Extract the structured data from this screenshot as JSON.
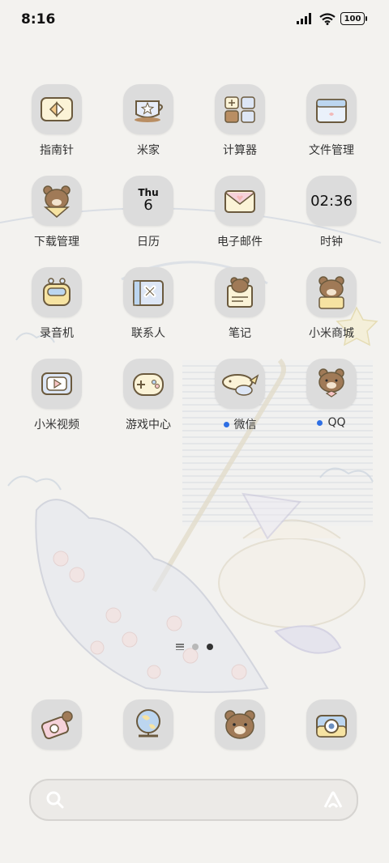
{
  "status": {
    "time": "8:16",
    "battery": "100"
  },
  "apps": [
    {
      "label": "指南针",
      "icon": "compass-icon"
    },
    {
      "label": "米家",
      "icon": "mijia-icon"
    },
    {
      "label": "计算器",
      "icon": "calculator-icon"
    },
    {
      "label": "文件管理",
      "icon": "file-manager-icon"
    },
    {
      "label": "下载管理",
      "icon": "download-manager-icon"
    },
    {
      "label": "日历",
      "icon": "calendar-icon",
      "day": "Thu",
      "date": "6"
    },
    {
      "label": "电子邮件",
      "icon": "email-icon"
    },
    {
      "label": "时钟",
      "icon": "clock-icon",
      "time": "02:36"
    },
    {
      "label": "录音机",
      "icon": "recorder-icon"
    },
    {
      "label": "联系人",
      "icon": "contacts-icon"
    },
    {
      "label": "笔记",
      "icon": "notes-icon"
    },
    {
      "label": "小米商城",
      "icon": "mi-store-icon"
    },
    {
      "label": "小米视频",
      "icon": "mi-video-icon"
    },
    {
      "label": "游戏中心",
      "icon": "game-center-icon"
    },
    {
      "label": "微信",
      "icon": "wechat-icon",
      "new": true
    },
    {
      "label": "QQ",
      "icon": "qq-icon",
      "new": true
    }
  ],
  "dock": [
    {
      "icon": "camera-bear-icon"
    },
    {
      "icon": "browser-globe-icon"
    },
    {
      "icon": "bear-face-icon"
    },
    {
      "icon": "camera-icon"
    }
  ],
  "page_indicator": {
    "pages": 2,
    "active": 2
  },
  "colors": {
    "tile": "#dcdcdc",
    "new_dot": "#2f6fe4",
    "background": "#f3f2ef"
  }
}
